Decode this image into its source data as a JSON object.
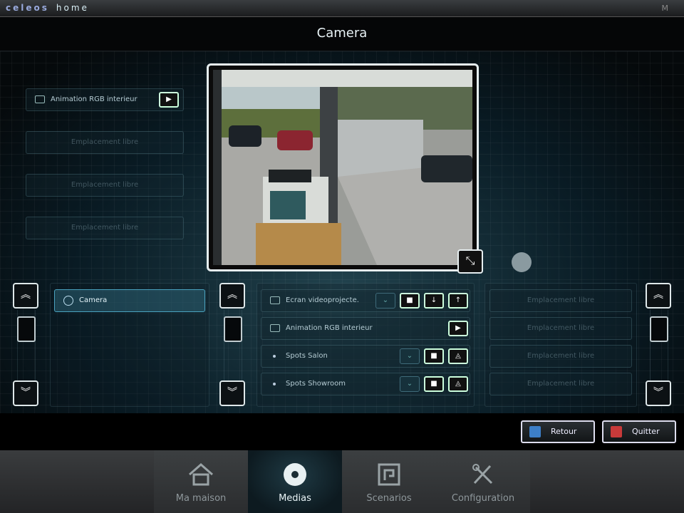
{
  "app": {
    "brand": "celeos",
    "brand_sub": "home",
    "corner": "M"
  },
  "page": {
    "title": "Camera"
  },
  "left_panel": {
    "items": [
      {
        "label": "Animation RGB interieur",
        "type": "scene"
      },
      {
        "label": "Emplacement libre",
        "type": "free"
      },
      {
        "label": "Emplacement libre",
        "type": "free"
      },
      {
        "label": "Emplacement libre",
        "type": "free"
      }
    ]
  },
  "camera_list": {
    "items": [
      {
        "label": "Camera",
        "selected": true
      }
    ]
  },
  "device_list": {
    "items": [
      {
        "label": "Ecran videoprojecte."
      },
      {
        "label": "Animation RGB interieur"
      },
      {
        "label": "Spots Salon"
      },
      {
        "label": "Spots Showroom"
      }
    ]
  },
  "right_list": {
    "items": [
      {
        "label": "Emplacement libre"
      },
      {
        "label": "Emplacement libre"
      },
      {
        "label": "Emplacement libre"
      },
      {
        "label": "Emplacement libre"
      }
    ]
  },
  "actions": {
    "back": "Retour",
    "quit": "Quitter"
  },
  "colors": {
    "accent": "#4aa3c0",
    "back": "#3d7fc8",
    "quit": "#c83a3a"
  },
  "tabs": [
    {
      "label": "Ma maison",
      "icon": "house-icon",
      "active": false
    },
    {
      "label": "Medias",
      "icon": "disc-icon",
      "active": true
    },
    {
      "label": "Scenarios",
      "icon": "scenario-icon",
      "active": false
    },
    {
      "label": "Configuration",
      "icon": "tools-icon",
      "active": false
    }
  ]
}
